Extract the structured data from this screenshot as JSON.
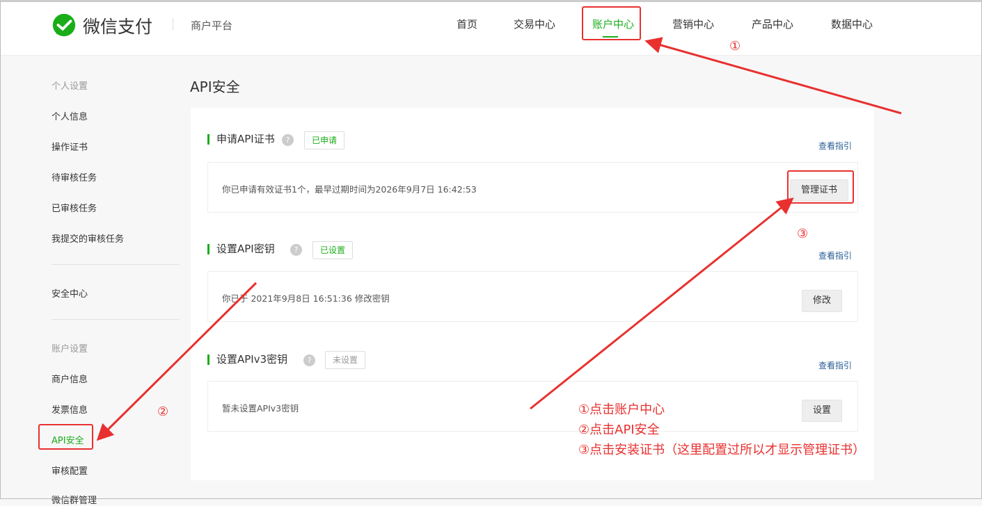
{
  "header": {
    "brand": "微信支付",
    "platform": "商户平台",
    "nav": [
      "首页",
      "交易中心",
      "账户中心",
      "营销中心",
      "产品中心",
      "数据中心"
    ],
    "active_nav": "账户中心",
    "accent": "#1aad19"
  },
  "sidebar": {
    "items": [
      "个人设置",
      "个人信息",
      "操作证书",
      "待审核任务",
      "已审核任务",
      "我提交的审核任务",
      "安全中心",
      "账户设置",
      "商户信息",
      "发票信息",
      "API安全",
      "审核配置",
      "微信群管理"
    ]
  },
  "main": {
    "title": "API安全",
    "sections": [
      {
        "title": "申请API证书",
        "help": "?",
        "status": "已申请",
        "guide": "查看指引",
        "text": "你已申请有效证书1个，最早过期时间为2026年9月7日 16:42:53",
        "button": "管理证书"
      },
      {
        "title": "设置API密钥",
        "help": "?",
        "status": "已设置",
        "guide": "查看指引",
        "text": "你已于 2021年9月8日 16:51:36 修改密钥",
        "button": "修改"
      },
      {
        "title": "设置APIv3密钥",
        "help": "?",
        "status": "未设置",
        "guide": "查看指引",
        "text": "暂未设置APIv3密钥",
        "button": "设置"
      }
    ]
  },
  "annotations": {
    "markers": [
      "①",
      "②",
      "③"
    ],
    "notes": [
      "①点击账户中心",
      "②点击API安全",
      "③点击安装证书（这里配置过所以才显示管理证书）"
    ],
    "color": "#e8302f"
  }
}
